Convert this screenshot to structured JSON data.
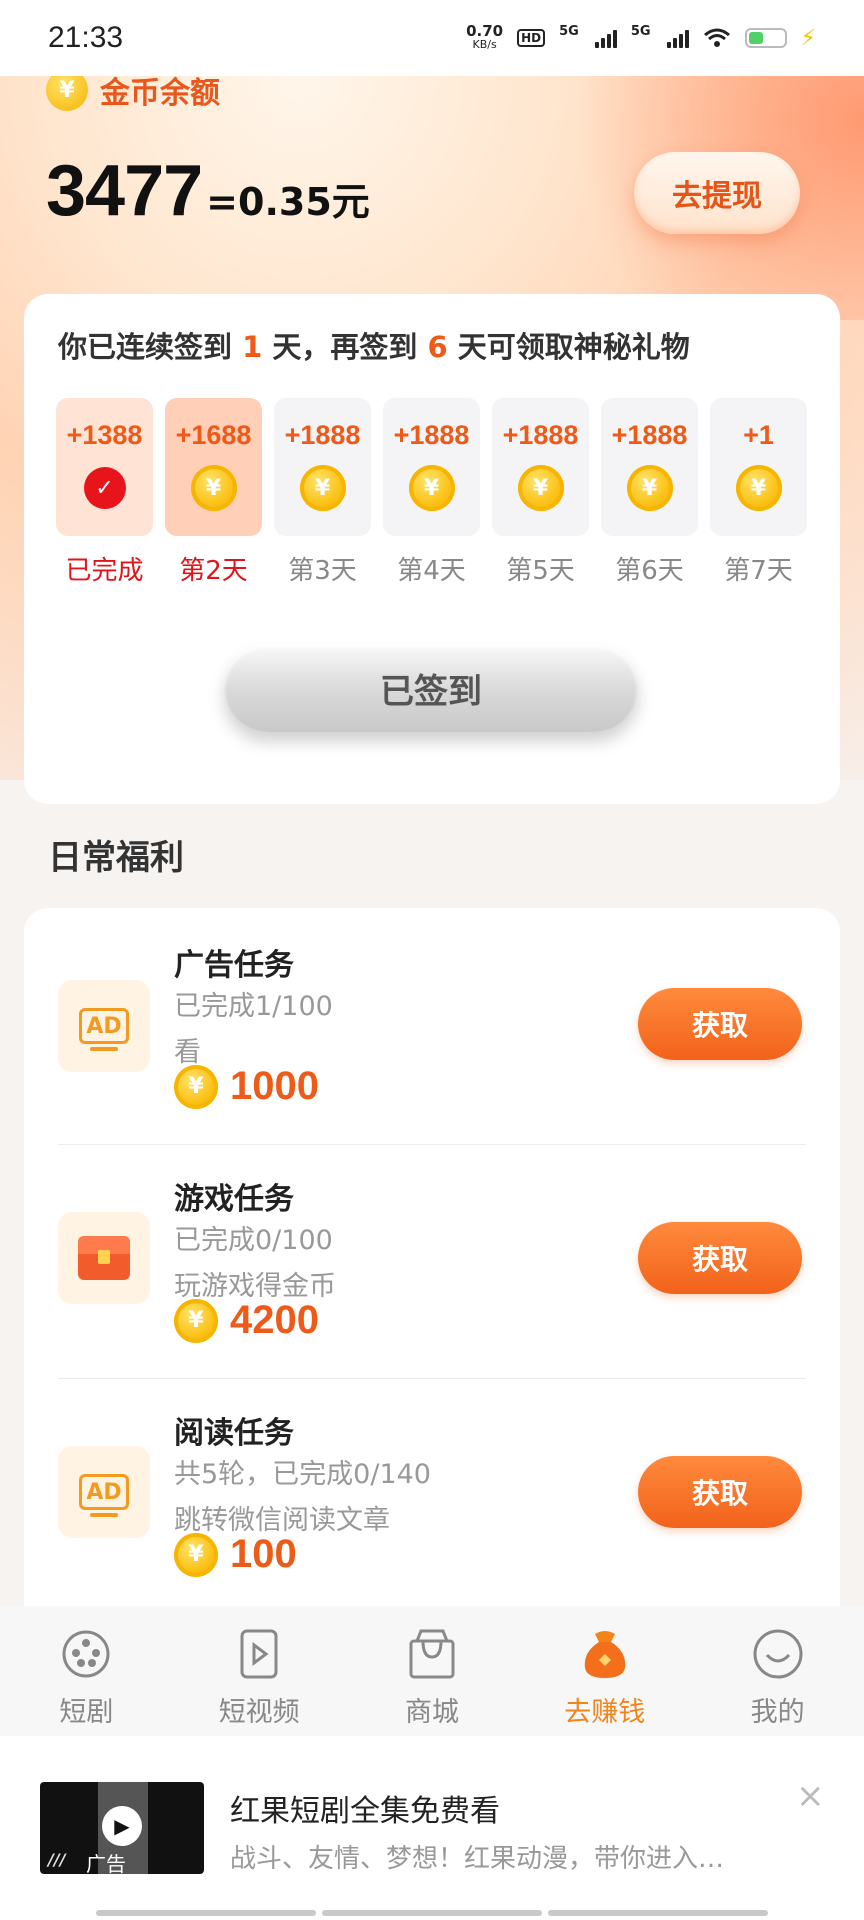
{
  "status_bar": {
    "time": "21:33",
    "net_speed_value": "0.70",
    "net_speed_unit": "KB/s",
    "hd_label": "HD",
    "signal_label": "5G"
  },
  "header": {
    "coin_label": "金币余额",
    "balance": "3477",
    "balance_equiv": "=0.35元",
    "withdraw_label": "去提现"
  },
  "signin": {
    "title_prefix": "你已连续签到 ",
    "days_signed": "1",
    "title_mid": " 天，再签到 ",
    "days_left": "6",
    "title_suffix": " 天可领取神秘礼物",
    "days": [
      {
        "amount": "+1388",
        "label": "已完成"
      },
      {
        "amount": "+1688",
        "label": "第2天"
      },
      {
        "amount": "+1888",
        "label": "第3天"
      },
      {
        "amount": "+1888",
        "label": "第4天"
      },
      {
        "amount": "+1888",
        "label": "第5天"
      },
      {
        "amount": "+1888",
        "label": "第6天"
      },
      {
        "amount": "+1",
        "label": "第7天"
      }
    ],
    "button_label": "已签到"
  },
  "daily": {
    "section_title": "日常福利",
    "tasks": [
      {
        "title": "广告任务",
        "progress": "已完成1/100",
        "desc": "看",
        "reward": "1000",
        "button": "获取"
      },
      {
        "title": "游戏任务",
        "progress": "已完成0/100",
        "desc": "玩游戏得金币",
        "reward": "4200",
        "button": "获取"
      },
      {
        "title": "阅读任务",
        "progress": "共5轮，已完成0/140",
        "desc": "跳转微信阅读文章",
        "reward": "100",
        "button": "获取"
      }
    ]
  },
  "nav": {
    "items": [
      {
        "label": "短剧"
      },
      {
        "label": "短视频"
      },
      {
        "label": "商城"
      },
      {
        "label": "去赚钱"
      },
      {
        "label": "我的"
      }
    ],
    "active_color": "#f2841b"
  },
  "ad": {
    "tag": "广告",
    "title": "红果短剧全集免费看",
    "desc": "战斗、友情、梦想！红果动漫，带你进入…",
    "close": "×"
  },
  "colors": {
    "accent": "#ee5a17",
    "button_gradient_end": "#f2621b",
    "coin": "#fbc31a"
  }
}
